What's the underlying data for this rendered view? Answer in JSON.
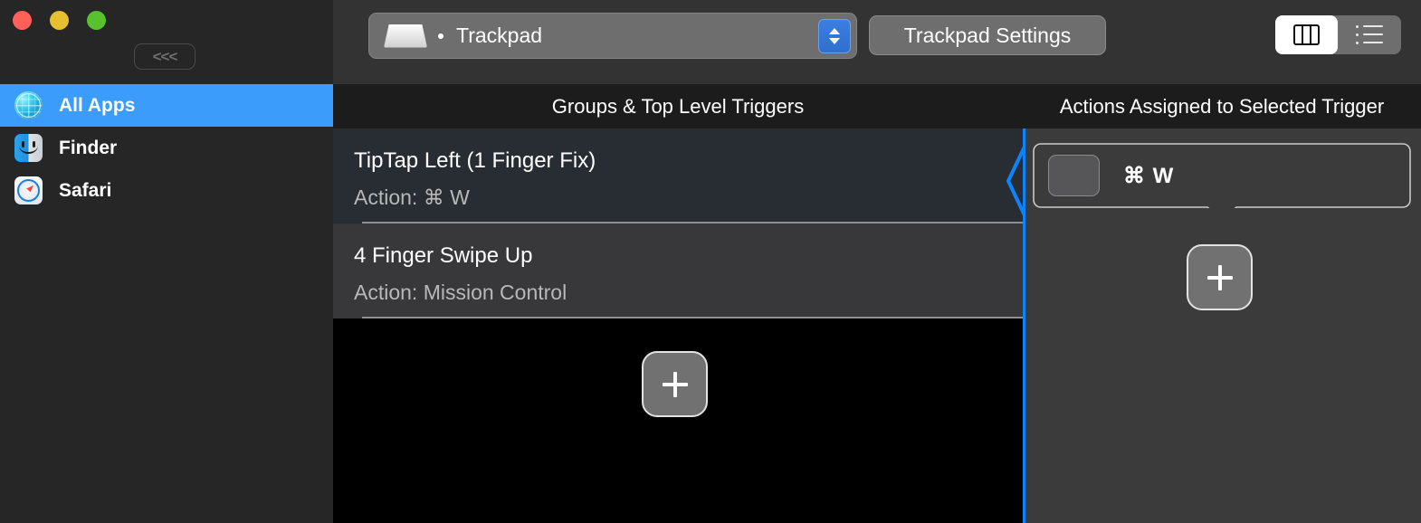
{
  "window": {
    "controls": [
      {
        "name": "close",
        "color": "#FF6159"
      },
      {
        "name": "minimize",
        "color": "#E6C02F"
      },
      {
        "name": "zoom",
        "color": "#57C22E"
      }
    ],
    "collapse_label": "<<<"
  },
  "sidebar": {
    "items": [
      {
        "label": "All Apps",
        "icon": "globe-icon",
        "selected": true
      },
      {
        "label": "Finder",
        "icon": "finder-icon",
        "selected": false
      },
      {
        "label": "Safari",
        "icon": "safari-icon",
        "selected": false
      }
    ],
    "selection_color": "#3B9CFC"
  },
  "toolbar": {
    "device_select": {
      "value": "Trackpad",
      "icon": "trackpad-icon",
      "stepper_icon": "stepper-up-down-icon"
    },
    "settings_button": "Trackpad Settings",
    "view_toggle": [
      {
        "icon": "column-view-icon",
        "active": true
      },
      {
        "icon": "list-view-icon",
        "active": false
      }
    ]
  },
  "columns": {
    "groups_header": "Groups & Top Level Triggers",
    "actions_header": "Actions Assigned to Selected Trigger"
  },
  "triggers": {
    "action_prefix": "Action: ",
    "items": [
      {
        "title": "TipTap Left (1 Finger Fix)",
        "action": "Action: ⌘ W",
        "selected": true
      },
      {
        "title": "4 Finger Swipe Up",
        "action": "Action: Mission Control",
        "selected": false
      }
    ],
    "add_button_label": "+"
  },
  "actions": {
    "assigned": [
      {
        "label": "⌘ W",
        "thumbnail": "action-thumbnail"
      }
    ],
    "add_button_label": "+"
  },
  "colors": {
    "accent_blue": "#0A84FF",
    "sidebar_bg": "#262626",
    "toolbar_bg": "#333334",
    "header_bg": "#1C1C1C",
    "row_selected_bg": "#282D33",
    "row_bg": "#38383A",
    "actions_bg": "#3B3B3C"
  }
}
